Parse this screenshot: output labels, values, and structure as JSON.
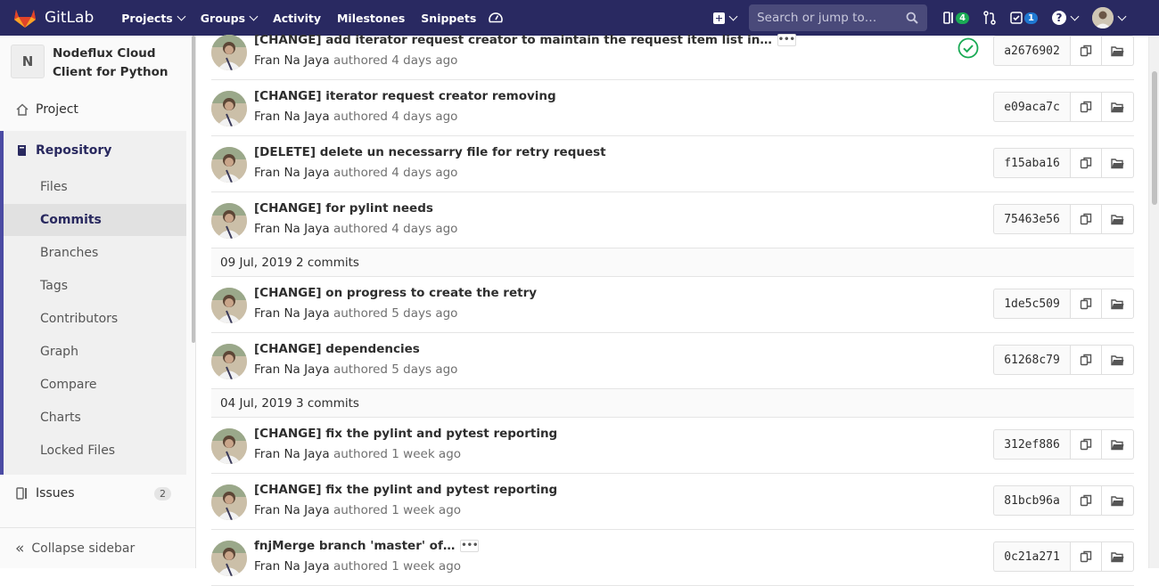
{
  "app": {
    "name": "GitLab"
  },
  "nav": {
    "links": [
      {
        "label": "Projects",
        "dropdown": true
      },
      {
        "label": "Groups",
        "dropdown": true
      },
      {
        "label": "Activity",
        "dropdown": false
      },
      {
        "label": "Milestones",
        "dropdown": false
      },
      {
        "label": "Snippets",
        "dropdown": false
      }
    ],
    "search_placeholder": "Search or jump to…",
    "issues_count": "4",
    "todos_count": "1",
    "help_label": "?"
  },
  "sidebar": {
    "project_initial": "N",
    "project_name": "Nodeflux Cloud Client for Python",
    "project_label": "Project",
    "repository_label": "Repository",
    "repo_items": [
      "Files",
      "Commits",
      "Branches",
      "Tags",
      "Contributors",
      "Graph",
      "Compare",
      "Charts",
      "Locked Files"
    ],
    "active_item": "Commits",
    "issues_label": "Issues",
    "issues_count": "2",
    "collapse_label": "Collapse sidebar"
  },
  "colors": {
    "navbar": "#292961",
    "accent": "#4b4ba3",
    "success": "#1aaa55"
  },
  "commits": {
    "rows": [
      {
        "title": "[CHANGE] add iterator request creator to maintain the request item list in…",
        "author": "Fran Na Jaya",
        "when": "authored 4 days ago",
        "sha": "a2676902",
        "expandable": true,
        "pipeline": "passed"
      },
      {
        "title": "[CHANGE] iterator request creator removing",
        "author": "Fran Na Jaya",
        "when": "authored 4 days ago",
        "sha": "e09aca7c"
      },
      {
        "title": "[DELETE] delete un necessarry file for retry request",
        "author": "Fran Na Jaya",
        "when": "authored 4 days ago",
        "sha": "f15aba16"
      },
      {
        "title": "[CHANGE] for pylint needs",
        "author": "Fran Na Jaya",
        "when": "authored 4 days ago",
        "sha": "75463e56"
      },
      {
        "day": "09 Jul, 2019",
        "count": "2 commits"
      },
      {
        "title": "[CHANGE] on progress to create the retry",
        "author": "Fran Na Jaya",
        "when": "authored 5 days ago",
        "sha": "1de5c509"
      },
      {
        "title": "[CHANGE] dependencies",
        "author": "Fran Na Jaya",
        "when": "authored 5 days ago",
        "sha": "61268c79"
      },
      {
        "day": "04 Jul, 2019",
        "count": "3 commits"
      },
      {
        "title": "[CHANGE] fix the pylint and pytest reporting",
        "author": "Fran Na Jaya",
        "when": "authored 1 week ago",
        "sha": "312ef886"
      },
      {
        "title": "[CHANGE] fix the pylint and pytest reporting",
        "author": "Fran Na Jaya",
        "when": "authored 1 week ago",
        "sha": "81bcb96a"
      },
      {
        "title": "fnjMerge branch 'master' of…",
        "author": "Fran Na Jaya",
        "when": "authored 1 week ago",
        "sha": "0c21a271",
        "expandable": true
      }
    ]
  }
}
